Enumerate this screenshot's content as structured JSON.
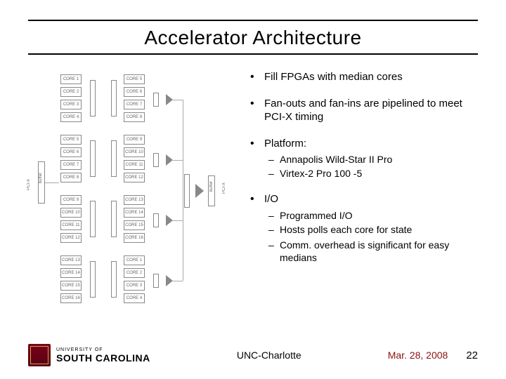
{
  "title": "Accelerator Architecture",
  "bullets": {
    "b1": "Fill FPGAs with median cores",
    "b2": "Fan-outs and fan-ins are pipelined to meet PCI-X timing",
    "b3": "Platform:",
    "b3_sub": {
      "s1": "Annapolis Wild-Star II Pro",
      "s2": "Virtex-2 Pro 100 -5"
    },
    "b4": "I/O",
    "b4_sub": {
      "s1": "Programmed I/O",
      "s2": "Hosts polls each core for state",
      "s3": "Comm. overhead is significant for easy medians"
    }
  },
  "diagram": {
    "left_label": "PCI-X",
    "right_label": "PCI-X",
    "buf": "buffer",
    "core_rows": [
      [
        "CORE 1",
        "CORE 5",
        "CORE 9",
        "CORE 13"
      ],
      [
        "CORE 2",
        "CORE 6",
        "CORE 10",
        "CORE 14"
      ],
      [
        "CORE 3",
        "CORE 7",
        "CORE 11",
        "CORE 15"
      ],
      [
        "CORE 4",
        "CORE 8",
        "CORE 12",
        "CORE 16"
      ]
    ]
  },
  "footer": {
    "logo_top": "UNIVERSITY OF",
    "logo_main": "SOUTH CAROLINA",
    "venue": "UNC-Charlotte",
    "date": "Mar. 28, 2008",
    "page": "22"
  }
}
